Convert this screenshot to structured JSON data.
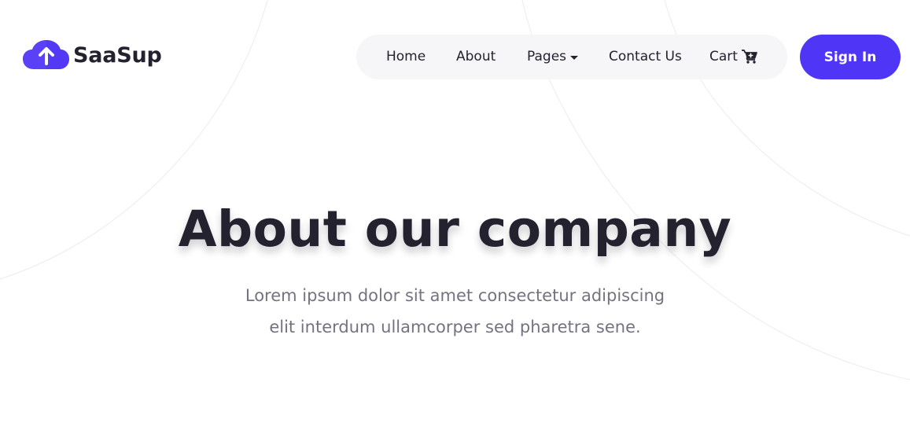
{
  "brand": {
    "name": "SaaSup",
    "accent_color": "#4f35f5",
    "logo_icon": "cloud-upload-icon"
  },
  "nav": {
    "items": [
      {
        "label": "Home"
      },
      {
        "label": "About"
      },
      {
        "label": "Pages",
        "icon": "caret-down-icon"
      },
      {
        "label": "Contact Us"
      },
      {
        "label": "Cart",
        "icon": "cart-plus-icon"
      }
    ],
    "background_color": "#f6f6f8"
  },
  "header": {
    "signin_label": "Sign In"
  },
  "hero": {
    "title": "About our company",
    "subtitle_line1": "Lorem ipsum dolor sit amet consectetur adipiscing",
    "subtitle_line2": "elit interdum ullamcorper sed pharetra sene."
  },
  "colors": {
    "text_dark": "#24222f",
    "text_muted": "#747380",
    "page_background": "#ffffff"
  }
}
